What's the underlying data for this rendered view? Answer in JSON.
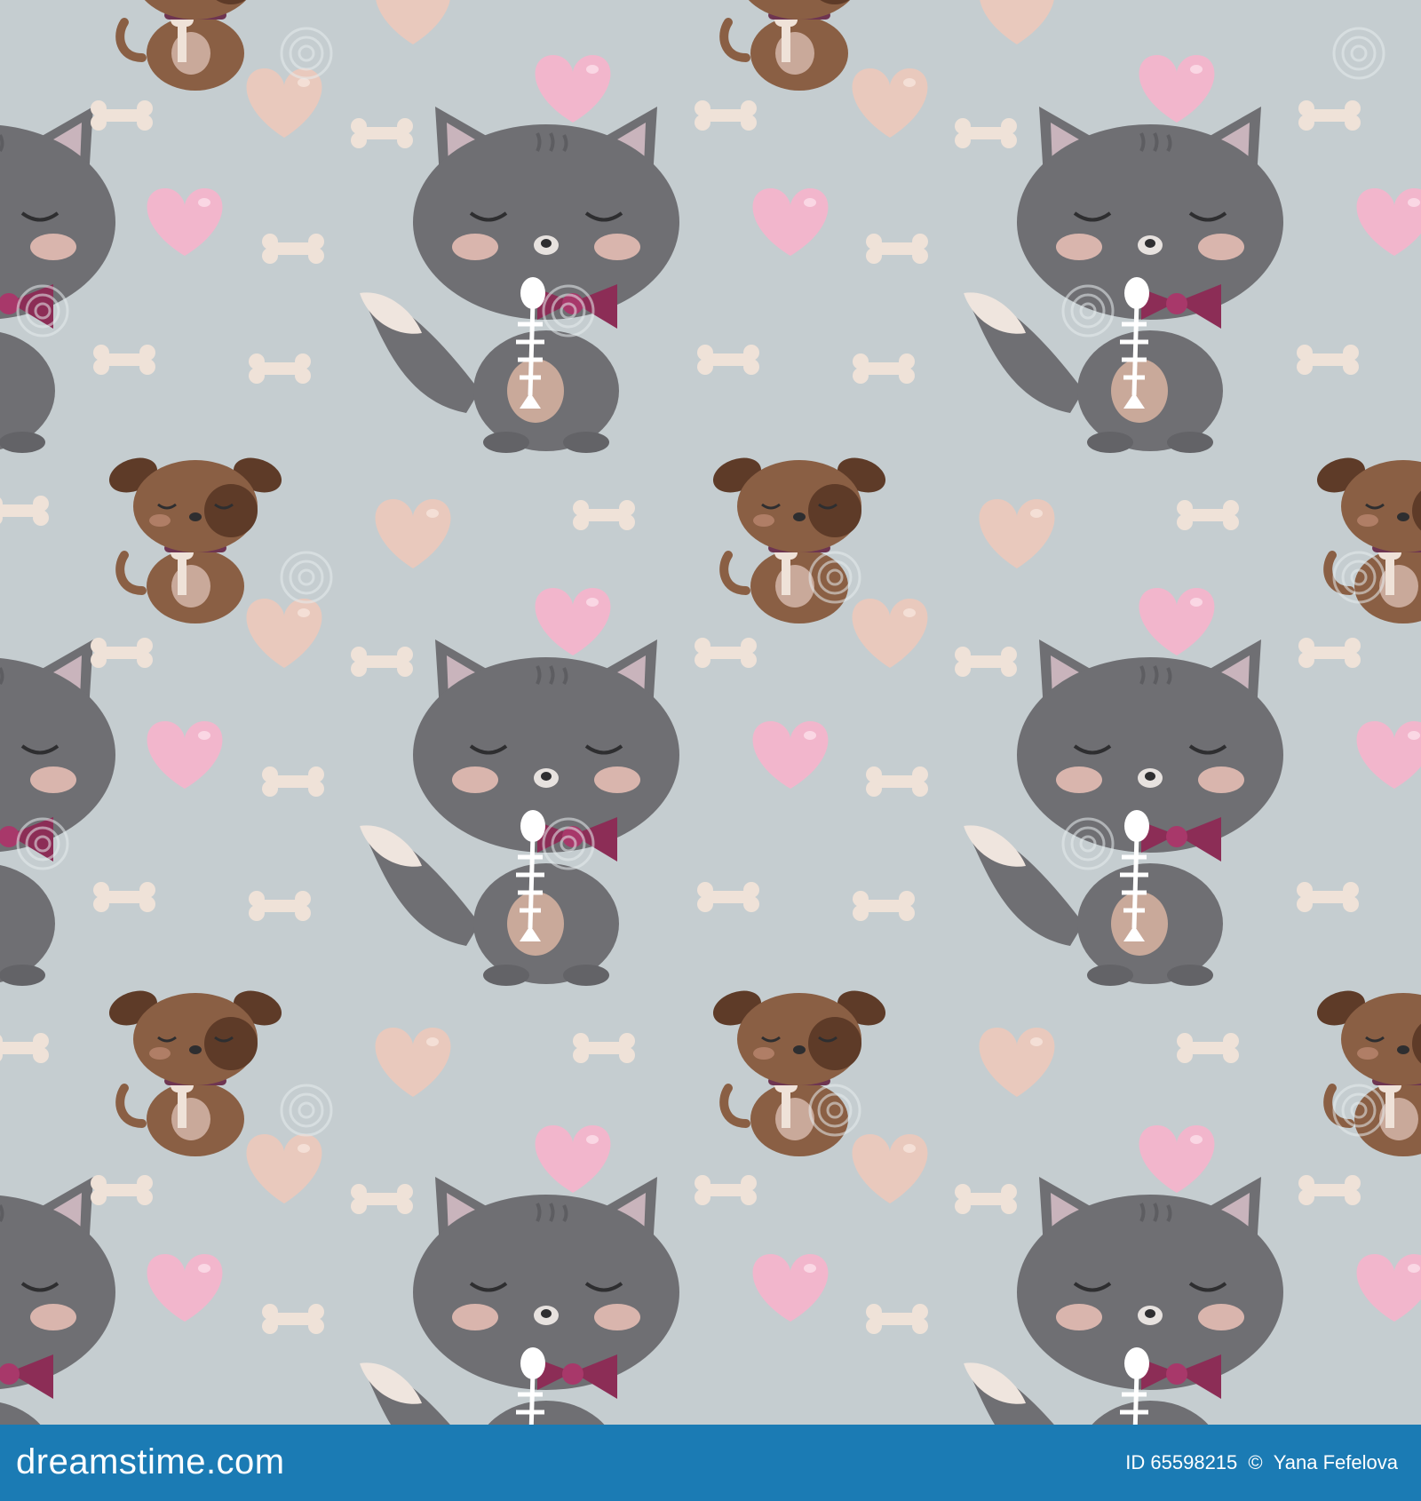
{
  "pattern": {
    "description_items": [
      "cat",
      "puppy",
      "heart",
      "bone"
    ],
    "colors": {
      "background": "#c5cdd0",
      "cat": "#6f6f73",
      "cat_ear_inner": "#c9b4bc",
      "cheek": "#d9b5ad",
      "bow": "#8c2d56",
      "puppy": "#8a5f44",
      "puppy_dark": "#5e3b28",
      "heart_pink": "#f2b6cc",
      "heart_beige": "#e9c9bd",
      "bone": "#efe2d8"
    }
  },
  "watermark": {
    "text": "dreamstime"
  },
  "footer": {
    "brand": "dreamstime.com",
    "id_label": "ID 65598215",
    "copyright": "©",
    "author": "Yana Fefelova",
    "background": "#1b7bb4"
  }
}
